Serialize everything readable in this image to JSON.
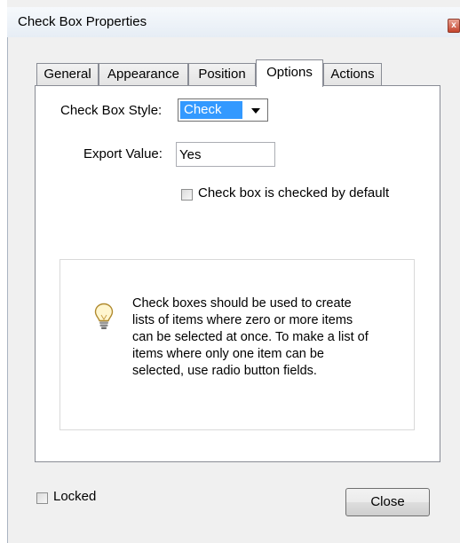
{
  "window": {
    "title": "Check Box Properties",
    "close_glyph": "x"
  },
  "tabs": [
    {
      "label": "General"
    },
    {
      "label": "Appearance"
    },
    {
      "label": "Position"
    },
    {
      "label": "Options",
      "active": true
    },
    {
      "label": "Actions"
    }
  ],
  "options": {
    "style_label": "Check Box Style:",
    "style_value": "Check",
    "export_label": "Export Value:",
    "export_value": "Yes",
    "default_checked_label": "Check box is checked by default",
    "default_checked": false
  },
  "info": {
    "icon": "lightbulb-icon",
    "text": "Check boxes should be used to create lists of items where zero or more items can be selected at once. To make a list of items where only one item can be selected, use radio button fields."
  },
  "footer": {
    "locked_label": "Locked",
    "locked": false,
    "close_label": "Close"
  },
  "colors": {
    "selection": "#3399ff",
    "border": "#898c95"
  }
}
